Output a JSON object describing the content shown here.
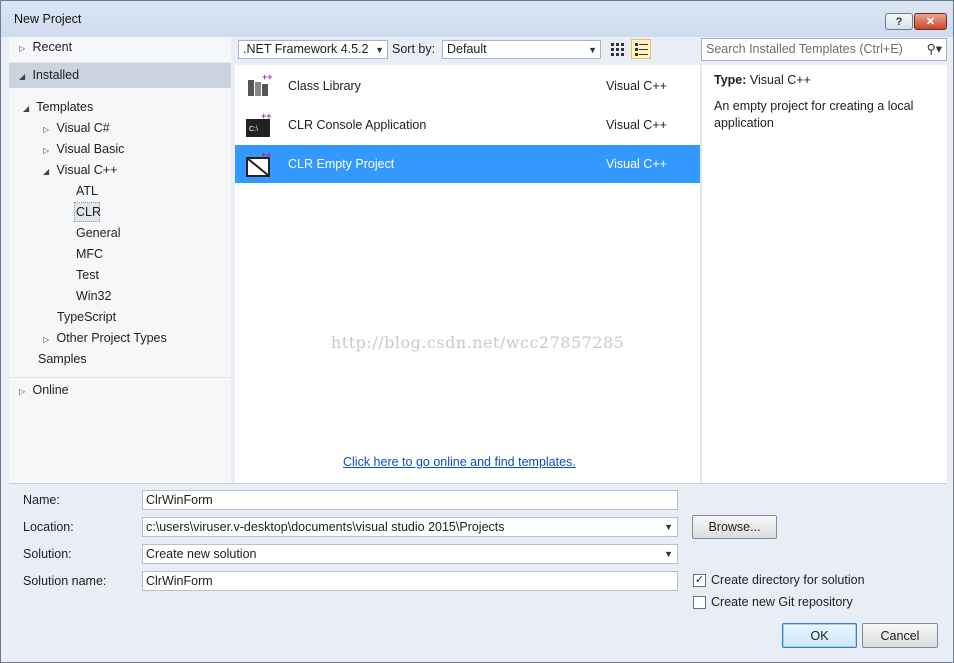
{
  "window": {
    "title": "New Project",
    "help_glyph": "?",
    "close_glyph": "✕"
  },
  "tree": {
    "recent": "Recent",
    "installed": "Installed",
    "templates": "Templates",
    "visual_csharp": "Visual C#",
    "visual_basic": "Visual Basic",
    "visual_cpp": "Visual C++",
    "atl": "ATL",
    "clr": "CLR",
    "general": "General",
    "mfc": "MFC",
    "test": "Test",
    "win32": "Win32",
    "typescript": "TypeScript",
    "other_project_types": "Other Project Types",
    "samples": "Samples",
    "online": "Online"
  },
  "toolbar": {
    "framework": ".NET Framework 4.5.2",
    "sort_by_label": "Sort by:",
    "sort_value": "Default",
    "search_placeholder": "Search Installed Templates (Ctrl+E)"
  },
  "templates": [
    {
      "name": "Class Library",
      "language": "Visual C++",
      "icon": "class-library-icon"
    },
    {
      "name": "CLR Console Application",
      "language": "Visual C++",
      "icon": "console-app-icon"
    },
    {
      "name": "CLR Empty Project",
      "language": "Visual C++",
      "icon": "empty-project-icon"
    }
  ],
  "selected_template_index": 2,
  "online_link": "Click here to go online and find templates.",
  "watermark": "http://blog.csdn.net/wcc27857285",
  "info": {
    "type_label": "Type:",
    "type_value": "Visual C++",
    "description": "An empty project for creating a local application"
  },
  "form": {
    "name_label": "Name:",
    "name_value": "ClrWinForm",
    "location_label": "Location:",
    "location_value": "c:\\users\\viruser.v-desktop\\documents\\visual studio 2015\\Projects",
    "solution_label": "Solution:",
    "solution_value": "Create new solution",
    "solution_name_label": "Solution name:",
    "solution_name_value": "ClrWinForm",
    "browse_button": "Browse...",
    "create_directory_label": "Create directory for solution",
    "create_directory_checked": true,
    "create_git_label": "Create new Git repository",
    "create_git_checked": false,
    "ok_button": "OK",
    "cancel_button": "Cancel"
  },
  "colors": {
    "selection": "#3399ff",
    "link": "#0b4dbf",
    "tree_selected": "#cbd3de"
  }
}
